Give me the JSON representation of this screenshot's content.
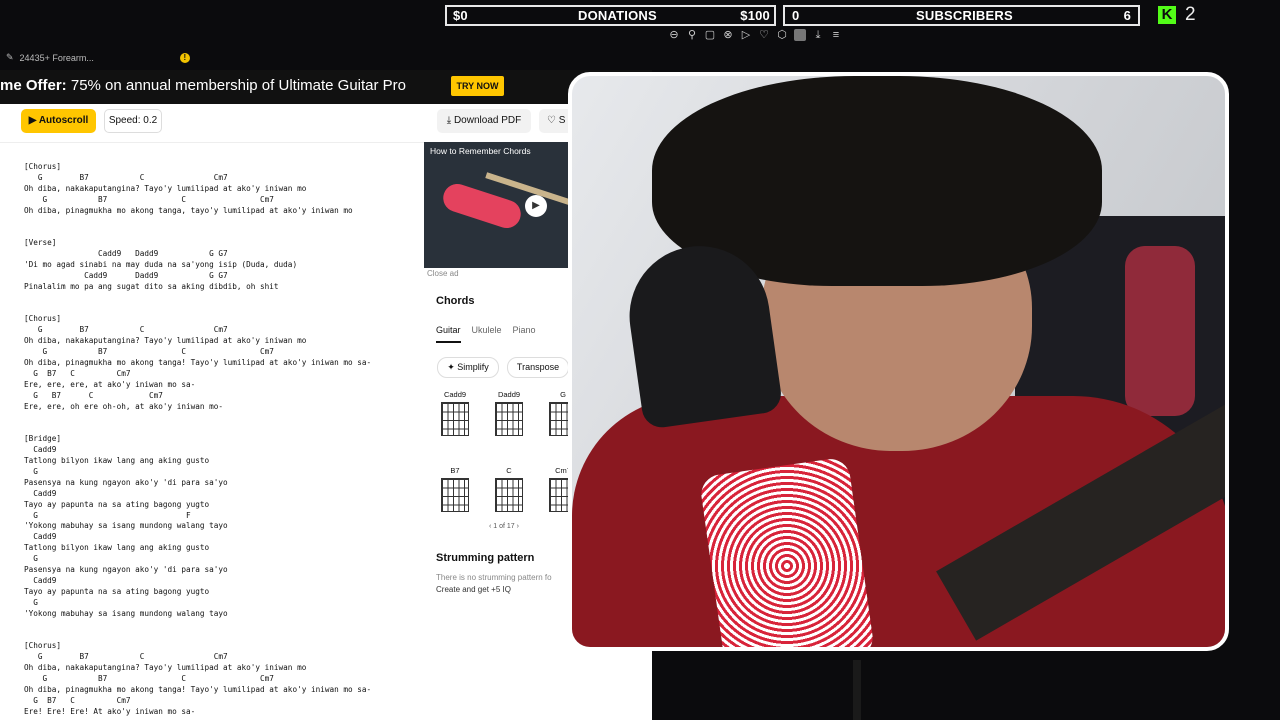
{
  "overlay": {
    "donations": {
      "left": "$0",
      "label": "DONATIONS",
      "right": "$100"
    },
    "subscribers": {
      "left": "0",
      "label": "SUBSCRIBERS",
      "right": "6"
    },
    "kick_count": "2",
    "kick_logo_letter": "K"
  },
  "browser": {
    "tab_title": "24435+ Forearm..."
  },
  "page": {
    "banner": {
      "prefix": "me Offer:",
      "text": " 75% on annual membership of Ultimate Guitar Pro",
      "button": "TRY NOW"
    },
    "toolbar": {
      "autoscroll": "▶ Autoscroll",
      "speed": "Speed: 0.2",
      "download": "⤓ Download PDF",
      "save": "♡ S"
    },
    "tab_lines": [
      "[Chorus]",
      "   G        B7           C               Cm7",
      "Oh diba, nakakaputangina? Tayo'y lumilipad at ako'y iniwan mo",
      "    G           B7                C                Cm7",
      "Oh diba, pinagmukha mo akong tanga, tayo'y lumilipad at ako'y iniwan mo",
      "",
      "",
      "[Verse]",
      "                Cadd9   Dadd9           G G7",
      "'Di mo agad sinabi na may duda na sa'yong isip (Duda, duda)",
      "             Cadd9      Dadd9           G G7",
      "Pinalalim mo pa ang sugat dito sa aking dibdib, oh shit",
      "",
      "",
      "[Chorus]",
      "   G        B7           C               Cm7",
      "Oh diba, nakakaputangina? Tayo'y lumilipad at ako'y iniwan mo",
      "    G           B7                C                Cm7",
      "Oh diba, pinagmukha mo akong tanga! Tayo'y lumilipad at ako'y iniwan mo sa-",
      "  G  B7   C         Cm7",
      "Ere, ere, ere, at ako'y iniwan mo sa-",
      "  G   B7      C            Cm7",
      "Ere, ere, oh ere oh-oh, at ako'y iniwan mo-",
      "",
      "",
      "[Bridge]",
      "  Cadd9",
      "Tatlong bilyon ikaw lang ang aking gusto",
      "  G",
      "Pasensya na kung ngayon ako'y 'di para sa'yo",
      "  Cadd9",
      "Tayo ay papunta na sa ating bagong yugto",
      "  G                                F",
      "'Yokong mabuhay sa isang mundong walang tayo",
      "  Cadd9",
      "Tatlong bilyon ikaw lang ang aking gusto",
      "  G",
      "Pasensya na kung ngayon ako'y 'di para sa'yo",
      "  Cadd9",
      "Tayo ay papunta na sa ating bagong yugto",
      "  G",
      "'Yokong mabuhay sa isang mundong walang tayo",
      "",
      "",
      "[Chorus]",
      "   G        B7           C               Cm7",
      "Oh diba, nakakaputangina? Tayo'y lumilipad at ako'y iniwan mo",
      "    G           B7                C                Cm7",
      "Oh diba, pinagmukha mo akong tanga! Tayo'y lumilipad at ako'y iniwan mo sa-",
      "  G  B7   C         Cm7",
      "Ere! Ere! Ere! At ako'y iniwan mo sa-"
    ],
    "ad": {
      "title": "How to Remember Chords",
      "close": "Close ad"
    },
    "chords": {
      "heading": "Chords",
      "instruments": [
        "Guitar",
        "Ukulele",
        "Piano"
      ],
      "simplify": "✦ Simplify",
      "transpose": "Transpose",
      "diagrams": [
        "Cadd9",
        "Dadd9",
        "G",
        "B7",
        "C",
        "Cm7"
      ],
      "pager": "‹  1 of 17  ›"
    },
    "strumming": {
      "heading": "Strumming pattern",
      "text": "There is no strumming pattern fo",
      "cta": "Create and get +5 IQ"
    }
  }
}
